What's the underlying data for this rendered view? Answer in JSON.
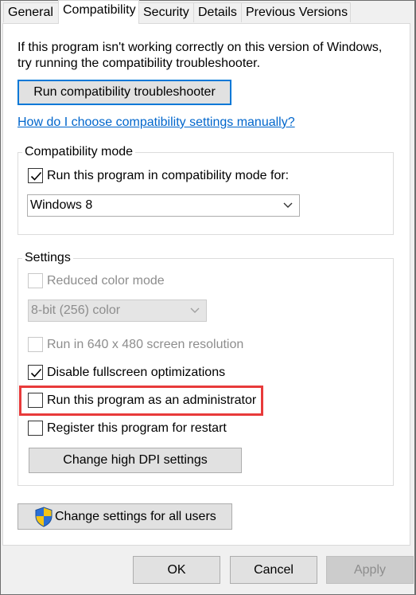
{
  "tabs": [
    "General",
    "Compatibility",
    "Security",
    "Details",
    "Previous Versions"
  ],
  "active_tab": "Compatibility",
  "intro_text": "If this program isn't working correctly on this version of Windows, try running the compatibility troubleshooter.",
  "troubleshooter_button": "Run compatibility troubleshooter",
  "help_link": "How do I choose compatibility settings manually?",
  "compat_mode": {
    "title": "Compatibility mode",
    "checkbox_label": "Run this program in compatibility mode for:",
    "checked": true,
    "selected_os": "Windows 8"
  },
  "settings": {
    "title": "Settings",
    "reduced_color": {
      "label": "Reduced color mode",
      "checked": false,
      "enabled": false
    },
    "color_select": {
      "value": "8-bit (256) color",
      "enabled": false
    },
    "res_640": {
      "label": "Run in 640 x 480 screen resolution",
      "checked": false,
      "enabled": false
    },
    "disable_fullscreen": {
      "label": "Disable fullscreen optimizations",
      "checked": true
    },
    "run_as_admin": {
      "label": "Run this program as an administrator",
      "checked": false,
      "highlighted": true
    },
    "register_restart": {
      "label": "Register this program for restart",
      "checked": false
    },
    "dpi_button": "Change high DPI settings"
  },
  "all_users_button": "Change settings for all users",
  "footer": {
    "ok": "OK",
    "cancel": "Cancel",
    "apply": "Apply"
  },
  "colors": {
    "highlight": "#e83a3a",
    "link": "#0066cc",
    "focus": "#0078d7"
  },
  "icons": {
    "shield": "uac-shield-icon",
    "check": "checkmark-icon",
    "dropdown": "chevron-down-icon"
  }
}
